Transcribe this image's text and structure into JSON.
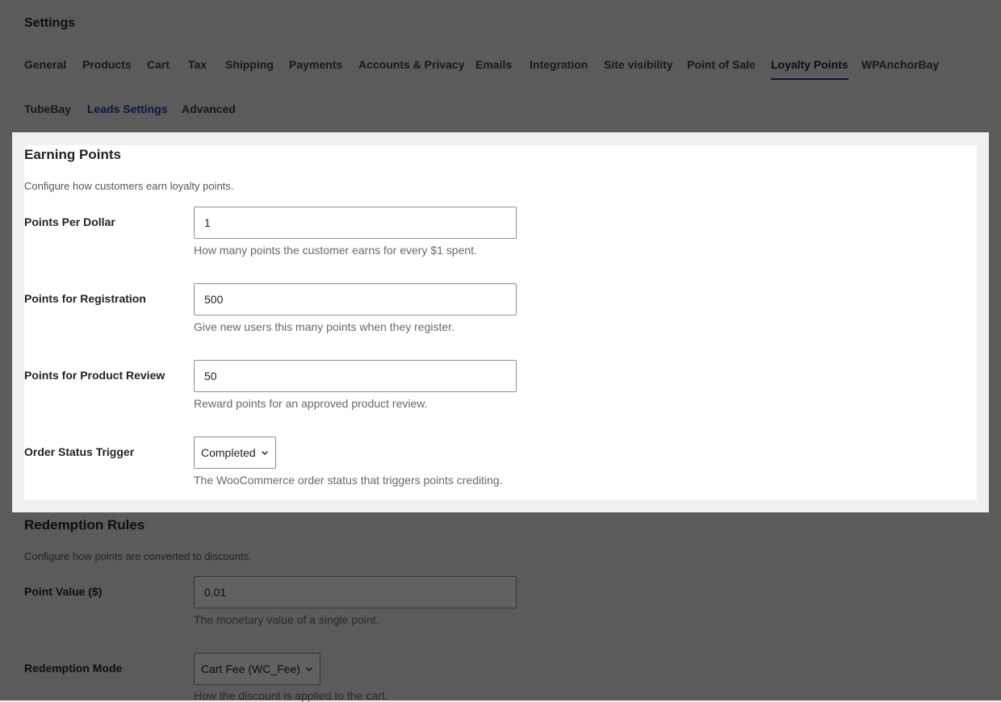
{
  "page": {
    "title": "Settings"
  },
  "tabs": {
    "row1": [
      {
        "label": "General"
      },
      {
        "label": "Products"
      },
      {
        "label": "Cart"
      },
      {
        "label": "Tax"
      },
      {
        "label": "Shipping"
      },
      {
        "label": "Payments"
      },
      {
        "label": "Accounts & Privacy"
      },
      {
        "label": "Emails"
      },
      {
        "label": "Integration"
      },
      {
        "label": "Site visibility"
      },
      {
        "label": "Point of Sale"
      },
      {
        "label": "Loyalty Points"
      },
      {
        "label": "WPAnchorBay"
      }
    ],
    "row2": [
      {
        "label": "TubeBay"
      },
      {
        "label": "Leads Settings"
      },
      {
        "label": "Advanced"
      }
    ],
    "active": "Loyalty Points"
  },
  "earning": {
    "title": "Earning Points",
    "description": "Configure how customers earn loyalty points.",
    "fields": [
      {
        "label": "Points Per Dollar",
        "value": "1",
        "help": "How many points the customer earns for every $1 spent."
      },
      {
        "label": "Points for Registration",
        "value": "500",
        "help": "Give new users this many points when they register."
      },
      {
        "label": "Points for Product Review",
        "value": "50",
        "help": "Reward points for an approved product review."
      }
    ],
    "order_status": {
      "label": "Order Status Trigger",
      "selected": "Completed",
      "help": "The WooCommerce order status that triggers points crediting."
    }
  },
  "redemption": {
    "title": "Redemption Rules",
    "description": "Configure how points are converted to discounts.",
    "point_value": {
      "label": "Point Value ($)",
      "value": "0.01",
      "help": "The monetary value of a single point."
    },
    "mode": {
      "label": "Redemption Mode",
      "selected": "Cart Fee (WC_Fee)",
      "help": "How the discount is applied to the cart."
    }
  },
  "colors": {
    "accent": "#2239a5",
    "overlay": "rgba(0,0,0,0.62)",
    "panel": "#ffffff"
  }
}
